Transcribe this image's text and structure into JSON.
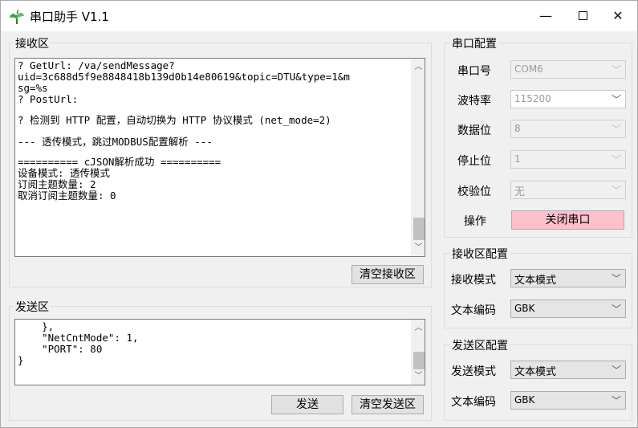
{
  "window": {
    "title": "串口助手 V1.1",
    "minimize": "—",
    "close": "✕"
  },
  "receive": {
    "group_title": "接收区",
    "lines": [
      "? GetUrl: /va/sendMessage?",
      "uid=3c688d5f9e8848418b139d0b14e80619&topic=DTU&type=1&m",
      "sg=%s",
      "? PostUrl:",
      "",
      "? 检测到 HTTP 配置，自动切换为 HTTP 协议模式 (net_mode=2)",
      "",
      "--- 透传模式，跳过MODBUS配置解析 ---",
      "",
      "========== cJSON解析成功 ==========",
      "设备模式: 透传模式",
      "订阅主题数量: 2",
      "取消订阅主题数量: 0"
    ],
    "clear_button": "清空接收区"
  },
  "send": {
    "group_title": "发送区",
    "lines": [
      "    },",
      "    \"NetCntMode\": 1,",
      "    \"PORT\": 80",
      "}"
    ],
    "send_button": "发送",
    "clear_button": "清空发送区"
  },
  "serial_config": {
    "group_title": "串口配置",
    "port_label": "串口号",
    "port_value": "COM6",
    "baud_label": "波特率",
    "baud_value": "115200",
    "databits_label": "数据位",
    "databits_value": "8",
    "stopbits_label": "停止位",
    "stopbits_value": "1",
    "parity_label": "校验位",
    "parity_value": "无",
    "action_label": "操作",
    "close_port_button": "关闭串口",
    "close_port_color": "#ffc0cb"
  },
  "receive_config": {
    "group_title": "接收区配置",
    "mode_label": "接收模式",
    "mode_value": "文本模式",
    "encoding_label": "文本编码",
    "encoding_value": "GBK"
  },
  "send_config": {
    "group_title": "发送区配置",
    "mode_label": "发送模式",
    "mode_value": "文本模式",
    "encoding_label": "文本编码",
    "encoding_value": "GBK"
  },
  "icons": {
    "app": "plant-icon",
    "chevron": "chevron-down-icon",
    "scroll_up": "scroll-up-icon",
    "scroll_down": "scroll-down-icon"
  }
}
